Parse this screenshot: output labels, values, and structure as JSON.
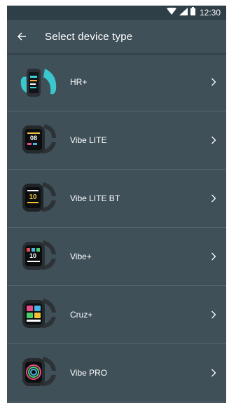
{
  "status_bar": {
    "time": "12:30"
  },
  "header": {
    "title": "Select device type"
  },
  "devices": [
    {
      "label": "HR+"
    },
    {
      "label": "Vibe LITE"
    },
    {
      "label": "Vibe LITE BT"
    },
    {
      "label": "Vibe+"
    },
    {
      "label": "Cruz+"
    },
    {
      "label": "Vibe PRO"
    }
  ],
  "colors": {
    "background": "#3f5059",
    "status_bar": "#2f3f47",
    "divider": "#566670",
    "text": "#ffffff"
  }
}
